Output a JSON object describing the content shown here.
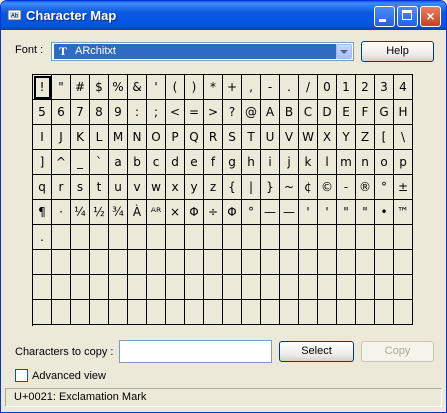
{
  "window": {
    "title": "Character Map",
    "buttons": {
      "minimize": "minimize",
      "maximize": "maximize",
      "close": "×"
    }
  },
  "font": {
    "label": "Font :",
    "value": "ARchitxt",
    "icon": "T",
    "options_visible": [
      "ARchitxt"
    ]
  },
  "help_label": "Help",
  "grid": {
    "selected_index": 0,
    "chars": [
      "!",
      "\"",
      "#",
      "$",
      "%",
      "&",
      "'",
      "(",
      ")",
      "*",
      "+",
      ",",
      "-",
      ".",
      "/",
      "0",
      "1",
      "2",
      "3",
      "4",
      "5",
      "6",
      "7",
      "8",
      "9",
      ":",
      ";",
      "<",
      "=",
      ">",
      "?",
      "@",
      "A",
      "B",
      "C",
      "D",
      "E",
      "F",
      "G",
      "H",
      "I",
      "J",
      "K",
      "L",
      "M",
      "N",
      "O",
      "P",
      "Q",
      "R",
      "S",
      "T",
      "U",
      "V",
      "W",
      "X",
      "Y",
      "Z",
      "[",
      "\\",
      "]",
      "^",
      "_",
      "`",
      "a",
      "b",
      "c",
      "d",
      "e",
      "f",
      "g",
      "h",
      "i",
      "j",
      "k",
      "l",
      "m",
      "n",
      "o",
      "p",
      "q",
      "r",
      "s",
      "t",
      "u",
      "v",
      "w",
      "x",
      "y",
      "z",
      "{",
      "|",
      "}",
      "~",
      "¢",
      "©",
      "-",
      "®",
      "°",
      "±",
      "¶",
      "·",
      "¼",
      "½",
      "¾",
      "À",
      "ᴬᴿ",
      "×",
      "Φ",
      "÷",
      "Φ",
      "°",
      "—",
      "—",
      "'",
      "'",
      "\"",
      "\"",
      "•",
      "™",
      ".",
      "",
      "",
      "",
      "",
      "",
      "",
      "",
      "",
      "",
      "",
      "",
      "",
      "",
      "",
      "",
      "",
      "",
      "",
      "",
      "",
      "",
      "",
      "",
      "",
      "",
      "",
      "",
      "",
      "",
      "",
      "",
      "",
      "",
      "",
      "",
      "",
      "",
      "",
      "",
      "",
      "",
      "",
      "",
      "",
      "",
      "",
      "",
      "",
      "",
      "",
      "",
      "",
      "",
      "",
      "",
      "",
      "",
      "",
      "",
      "",
      "",
      "",
      "",
      "",
      "",
      "",
      "",
      "",
      "",
      "",
      "",
      "",
      "",
      "",
      "",
      "",
      "",
      "",
      ""
    ]
  },
  "copy": {
    "label": "Characters to copy :",
    "value": "",
    "select_label": "Select",
    "copy_label": "Copy"
  },
  "advanced": {
    "label": "Advanced view",
    "checked": false
  },
  "status": "U+0021: Exclamation Mark"
}
